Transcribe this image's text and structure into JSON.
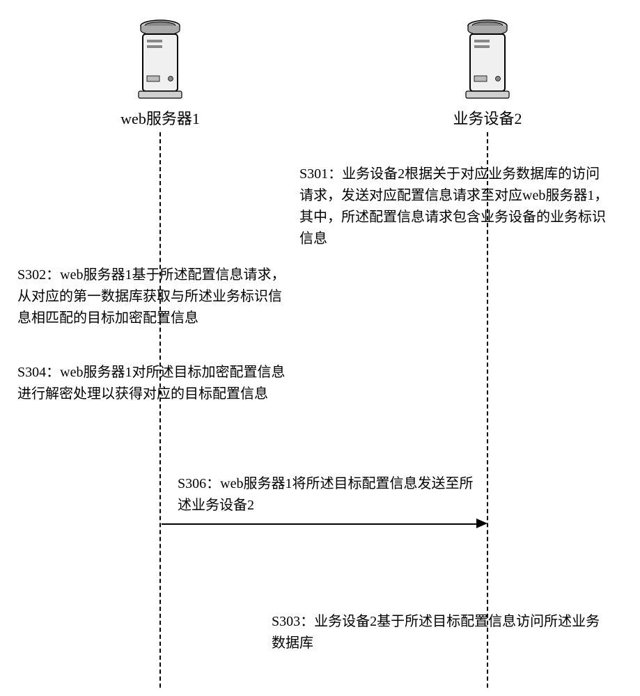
{
  "participants": {
    "web_server": {
      "label": "web服务器1"
    },
    "business_device": {
      "label": "业务设备2"
    }
  },
  "steps": {
    "s301": "S301：业务设备2根据关于对应业务数据库的访问请求，发送对应配置信息请求至对应web服务器1，其中，所述配置信息请求包含业务设备的业务标识信息",
    "s302": "S302：web服务器1基于所述配置信息请求，从对应的第一数据库获取与所述业务标识信息相匹配的目标加密配置信息",
    "s304": "S304：web服务器1对所述目标加密配置信息进行解密处理以获得对应的目标配置信息",
    "s306": "S306：web服务器1将所述目标配置信息发送至所述业务设备2",
    "s303": "S303：业务设备2基于所述目标配置信息访问所述业务数据库"
  }
}
